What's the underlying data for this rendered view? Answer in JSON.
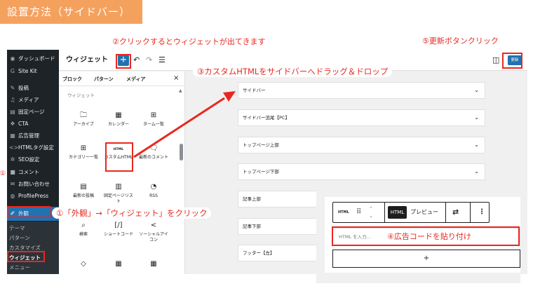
{
  "banner": {
    "title": "設置方法（サイドバー）"
  },
  "colors": {
    "accent": "#2271b1",
    "annotation": "#e8281f",
    "banner": "#f5a15e",
    "admin_bg": "#1d2327"
  },
  "admin_menu": {
    "items": [
      {
        "icon": "dashboard-icon",
        "glyph": "◉",
        "label": "ダッシュボード"
      },
      {
        "icon": "sitekit-icon",
        "glyph": "G",
        "label": "Site Kit"
      },
      {
        "icon": "posts-icon",
        "glyph": "✎",
        "label": "投稿"
      },
      {
        "icon": "media-icon",
        "glyph": "♫",
        "label": "メディア"
      },
      {
        "icon": "pages-icon",
        "glyph": "▤",
        "label": "固定ページ"
      },
      {
        "icon": "cta-icon",
        "glyph": "❖",
        "label": "CTA"
      },
      {
        "icon": "ads-icon",
        "glyph": "▦",
        "label": "広告管理"
      },
      {
        "icon": "code-icon",
        "glyph": "<>",
        "label": "HTMLタグ設定"
      },
      {
        "icon": "seo-icon",
        "glyph": "✲",
        "label": "SEO設定"
      },
      {
        "icon": "comments-icon",
        "glyph": "■",
        "label": "コメント"
      },
      {
        "icon": "mail-icon",
        "glyph": "✉",
        "label": "お問い合わせ"
      },
      {
        "icon": "profilepress-icon",
        "glyph": "◍",
        "label": "ProfilePress"
      },
      {
        "icon": "appearance-icon",
        "glyph": "✐",
        "label": "外観"
      }
    ],
    "submenu": [
      "テーマ",
      "パターン",
      "カスタマイズ",
      "ウィジェット",
      "メニュー"
    ]
  },
  "editor": {
    "title": "ウィジェット",
    "add_label": "+",
    "undo": "↶",
    "redo": "↷",
    "list_view": "☰",
    "sidebar_toggle": "◫",
    "update_label": "更新"
  },
  "inserter": {
    "tabs": [
      "ブロック",
      "パターン",
      "メディア"
    ],
    "close": "×",
    "category": "ウィジェット",
    "blocks": [
      {
        "icon": "archive-icon",
        "glyph": "🗀",
        "label": "アーカイブ"
      },
      {
        "icon": "calendar-icon",
        "glyph": "▦",
        "label": "カレンダー"
      },
      {
        "icon": "tag-cloud-icon",
        "glyph": "⊞",
        "label": "ターム一覧"
      },
      {
        "icon": "categories-icon",
        "glyph": "⊞",
        "label": "カテゴリー一覧"
      },
      {
        "icon": "custom-html-icon",
        "glyph": "HTML",
        "label": "カスタムHTML"
      },
      {
        "icon": "latest-comments-icon",
        "glyph": "🗨",
        "label": "最新のコメント"
      },
      {
        "icon": "latest-posts-icon",
        "glyph": "▤",
        "label": "最新の投稿"
      },
      {
        "icon": "page-list-icon",
        "glyph": "▥",
        "label": "固定ページリスト"
      },
      {
        "icon": "rss-icon",
        "glyph": "◔",
        "label": "RSS"
      },
      {
        "icon": "search-icon",
        "glyph": "⌕",
        "label": "検索"
      },
      {
        "icon": "shortcode-icon",
        "glyph": "[/]",
        "label": "ショートコード"
      },
      {
        "icon": "social-icon",
        "glyph": "<",
        "label": "ソーシャルアイコン"
      },
      {
        "icon": "tag-icon",
        "glyph": "◇",
        "label": ""
      },
      {
        "icon": "calendar-small-icon",
        "glyph": "▦",
        "label": ""
      },
      {
        "icon": "calendar-small-icon",
        "glyph": "▦",
        "label": ""
      }
    ]
  },
  "widget_areas": [
    "サイドバー",
    "サイドバー追尾【PC】",
    "トップページ上部",
    "トップページ下部",
    "記事上部",
    "記事下部",
    "フッター【左】"
  ],
  "zoom": {
    "html_label": "HTML",
    "drag": "⠿",
    "up": "⌃",
    "down": "⌄",
    "html_btn": "HTML",
    "preview": "プレビュー",
    "transform": "⇄",
    "more": "⋮",
    "input_placeholder": "HTML を入力…",
    "add": "+"
  },
  "annotations": {
    "step1": "①「外観」→「ウィジェット」をクリック",
    "step2": "②クリックするとウィジェットが出てきます",
    "step3": "③カスタムHTMLをサイドバーへドラッグ＆ドロップ",
    "step4": "④広告コードを貼り付け",
    "step5": "⑤更新ボタンクリック",
    "edge_mark": "①"
  }
}
